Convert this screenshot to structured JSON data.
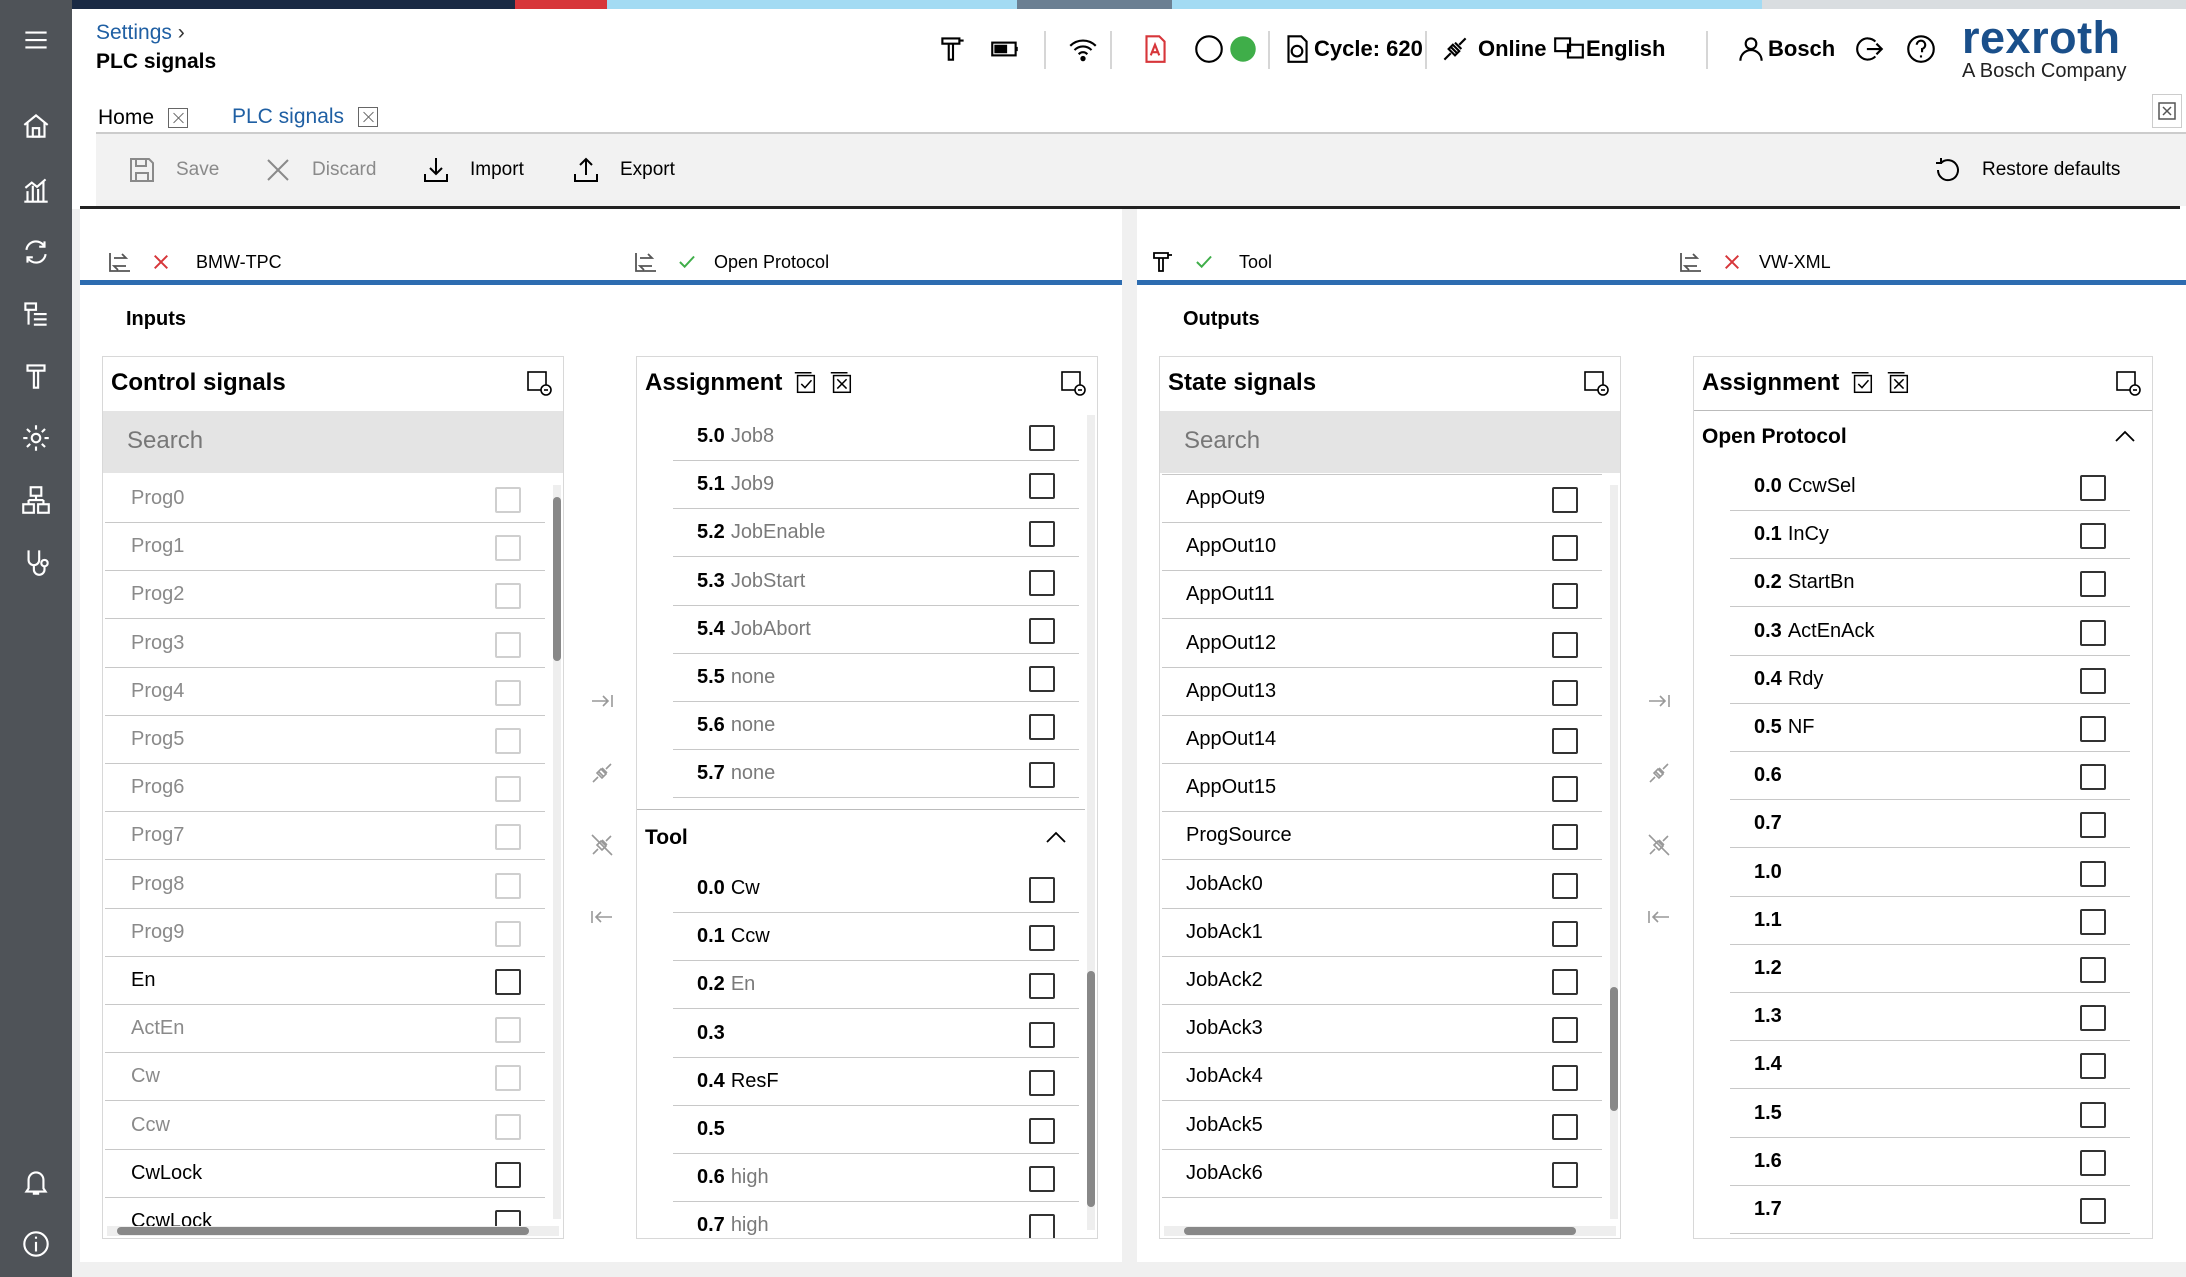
{
  "stripe_colors": [
    "#1a2a44",
    "#1a2a44",
    "#d7363a",
    "#a3dbf3",
    "#a3dbf3",
    "#6b7f92",
    "#a3dbf3",
    "#d9dde0"
  ],
  "header": {
    "breadcrumb": "Settings",
    "page_title": "PLC signals",
    "cycle_label": "Cycle: 620",
    "online_label": "Online",
    "language_label": "English",
    "user_label": "Bosch",
    "brand_name": "rexroth",
    "brand_tagline": "A Bosch Company"
  },
  "tabs": [
    {
      "label": "Home"
    },
    {
      "label": "PLC signals"
    }
  ],
  "toolbar": {
    "save": "Save",
    "discard": "Discard",
    "import": "Import",
    "export": "Export",
    "restore": "Restore defaults"
  },
  "protocol_tabs": [
    {
      "label": "BMW-TPC",
      "status": "error"
    },
    {
      "label": "Open Protocol",
      "status": "ok"
    },
    {
      "label": "Tool",
      "status": "ok"
    },
    {
      "label": "VW-XML",
      "status": "error"
    }
  ],
  "inputs": {
    "section_title": "Inputs",
    "control_signals": {
      "title": "Control signals",
      "search_placeholder": "Search",
      "items": [
        {
          "label": "Prog0",
          "enabled": false
        },
        {
          "label": "Prog1",
          "enabled": false
        },
        {
          "label": "Prog2",
          "enabled": false
        },
        {
          "label": "Prog3",
          "enabled": false
        },
        {
          "label": "Prog4",
          "enabled": false
        },
        {
          "label": "Prog5",
          "enabled": false
        },
        {
          "label": "Prog6",
          "enabled": false
        },
        {
          "label": "Prog7",
          "enabled": false
        },
        {
          "label": "Prog8",
          "enabled": false
        },
        {
          "label": "Prog9",
          "enabled": false
        },
        {
          "label": "En",
          "enabled": true
        },
        {
          "label": "ActEn",
          "enabled": false
        },
        {
          "label": "Cw",
          "enabled": false
        },
        {
          "label": "Ccw",
          "enabled": false
        },
        {
          "label": "CwLock",
          "enabled": true
        },
        {
          "label": "CcwLock",
          "enabled": true
        }
      ]
    },
    "assignment": {
      "title": "Assignment",
      "rows_top": [
        {
          "addr": "5.0",
          "name": "Job8"
        },
        {
          "addr": "5.1",
          "name": "Job9"
        },
        {
          "addr": "5.2",
          "name": "JobEnable"
        },
        {
          "addr": "5.3",
          "name": "JobStart"
        },
        {
          "addr": "5.4",
          "name": "JobAbort"
        },
        {
          "addr": "5.5",
          "name": "none"
        },
        {
          "addr": "5.6",
          "name": "none"
        },
        {
          "addr": "5.7",
          "name": "none"
        }
      ],
      "group": "Tool",
      "rows_group": [
        {
          "addr": "0.0",
          "name": "Cw",
          "dark": true
        },
        {
          "addr": "0.1",
          "name": "Ccw",
          "dark": true
        },
        {
          "addr": "0.2",
          "name": "En",
          "dark": false
        },
        {
          "addr": "0.3",
          "name": "",
          "dark": true
        },
        {
          "addr": "0.4",
          "name": "ResF",
          "dark": true
        },
        {
          "addr": "0.5",
          "name": "",
          "dark": true
        },
        {
          "addr": "0.6",
          "name": "high",
          "dark": false
        },
        {
          "addr": "0.7",
          "name": "high",
          "dark": false
        }
      ]
    }
  },
  "outputs": {
    "section_title": "Outputs",
    "state_signals": {
      "title": "State signals",
      "search_placeholder": "Search",
      "items": [
        "AppOut9",
        "AppOut10",
        "AppOut11",
        "AppOut12",
        "AppOut13",
        "AppOut14",
        "AppOut15",
        "ProgSource",
        "JobAck0",
        "JobAck1",
        "JobAck2",
        "JobAck3",
        "JobAck4",
        "JobAck5",
        "JobAck6"
      ]
    },
    "assignment": {
      "title": "Assignment",
      "group": "Open Protocol",
      "rows": [
        {
          "addr": "0.0",
          "name": "CcwSel"
        },
        {
          "addr": "0.1",
          "name": "InCy"
        },
        {
          "addr": "0.2",
          "name": "StartBn"
        },
        {
          "addr": "0.3",
          "name": "ActEnAck"
        },
        {
          "addr": "0.4",
          "name": "Rdy"
        },
        {
          "addr": "0.5",
          "name": "NF"
        },
        {
          "addr": "0.6",
          "name": ""
        },
        {
          "addr": "0.7",
          "name": ""
        },
        {
          "addr": "1.0",
          "name": ""
        },
        {
          "addr": "1.1",
          "name": ""
        },
        {
          "addr": "1.2",
          "name": ""
        },
        {
          "addr": "1.3",
          "name": ""
        },
        {
          "addr": "1.4",
          "name": ""
        },
        {
          "addr": "1.5",
          "name": ""
        },
        {
          "addr": "1.6",
          "name": ""
        },
        {
          "addr": "1.7",
          "name": ""
        }
      ]
    }
  }
}
